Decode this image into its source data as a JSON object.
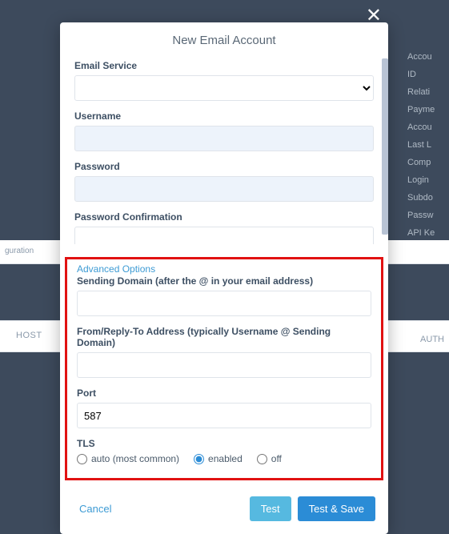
{
  "bg": {
    "items": [
      "Accou",
      "ID",
      "Relati",
      "Payme",
      "Accou",
      "Last L",
      "Comp",
      "Login",
      "Subdo",
      "Passw",
      "API Ke"
    ],
    "strip": "guration",
    "tab_left": "HOST",
    "tab_right": "AUTH"
  },
  "dialog": {
    "title": "New Email Account",
    "emailService": {
      "label": "Email Service",
      "value": ""
    },
    "username": {
      "label": "Username",
      "value": ""
    },
    "password": {
      "label": "Password",
      "value": ""
    },
    "passwordConfirm": {
      "label": "Password Confirmation",
      "value": ""
    },
    "advanced": {
      "heading": "Advanced Options",
      "sendingDomain": {
        "label": "Sending Domain (after the @ in your email address)",
        "value": ""
      },
      "fromReply": {
        "label": "From/Reply-To Address (typically Username @ Sending Domain)",
        "value": ""
      },
      "port": {
        "label": "Port",
        "value": "587"
      },
      "tls": {
        "label": "TLS",
        "options": {
          "auto": "auto (most common)",
          "enabled": "enabled",
          "off": "off"
        },
        "selected": "enabled"
      }
    },
    "buttons": {
      "cancel": "Cancel",
      "test": "Test",
      "testSave": "Test & Save"
    }
  }
}
